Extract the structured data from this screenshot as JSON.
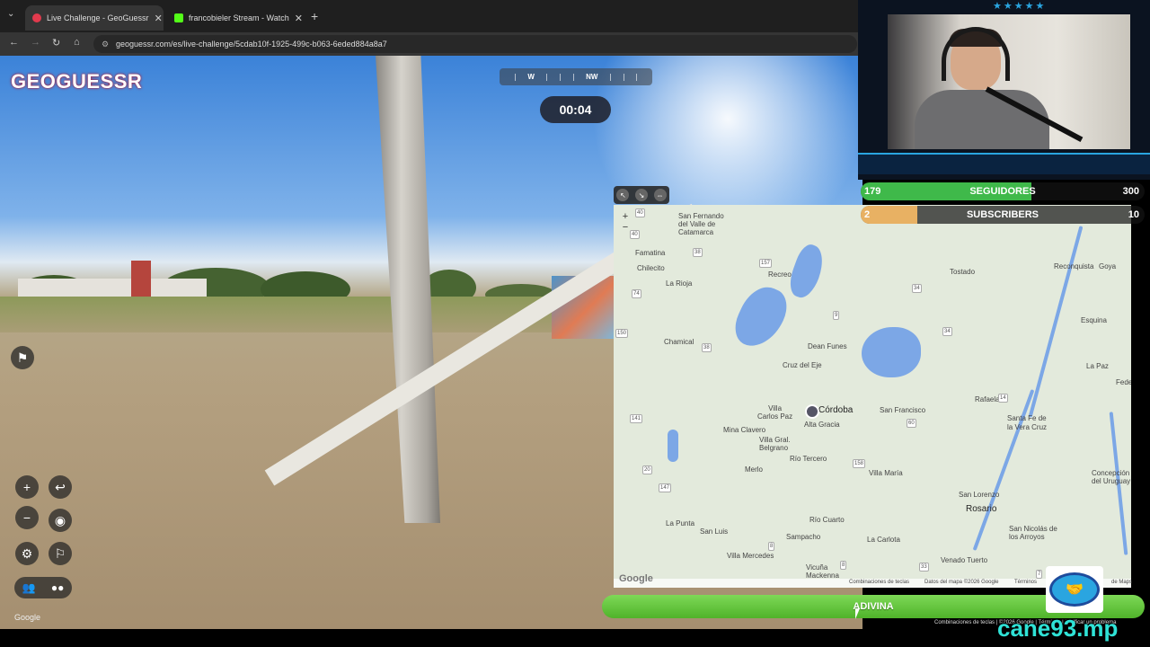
{
  "browser": {
    "tabs": [
      {
        "title": "Live Challenge - GeoGuessr",
        "active": true,
        "favicon_color": "#e23a4d"
      },
      {
        "title": "francobieler Stream - Watch",
        "active": false,
        "favicon_color": "#53fc18"
      }
    ],
    "url": "geoguessr.com/es/live-challenge/5cdab10f-1925-499c-b063-6eded884a8a7"
  },
  "game": {
    "logo": "GEOGUESSR",
    "compass": [
      "W",
      "NW"
    ],
    "timer": "00:04",
    "guess_button": "ADIVINA",
    "google_watermark": "Google"
  },
  "map": {
    "cities": [
      {
        "name": "San Fernando\ndel Valle de\nCatamarca",
        "key": "catamarca"
      },
      {
        "name": "Famatina",
        "key": "famatina"
      },
      {
        "name": "Chilecito",
        "key": "chilecito"
      },
      {
        "name": "La Rioja",
        "key": "larioja"
      },
      {
        "name": "Recreo",
        "key": "recreo"
      },
      {
        "name": "Tostado",
        "key": "tostado"
      },
      {
        "name": "Reconquista",
        "key": "reconquista"
      },
      {
        "name": "Goya",
        "key": "goya"
      },
      {
        "name": "Esquina",
        "key": "esquina"
      },
      {
        "name": "Chamical",
        "key": "chamical"
      },
      {
        "name": "Dean Funes",
        "key": "deanfunes"
      },
      {
        "name": "Cruz del Eje",
        "key": "cruzdeleje"
      },
      {
        "name": "La Paz",
        "key": "lapaz"
      },
      {
        "name": "Villa\nCarlos Paz",
        "key": "carlospaz"
      },
      {
        "name": "Córdoba",
        "key": "cordoba"
      },
      {
        "name": "Alta Gracia",
        "key": "altagracia"
      },
      {
        "name": "San Francisco",
        "key": "sanfrancisco"
      },
      {
        "name": "Rafaela",
        "key": "rafaela"
      },
      {
        "name": "Santa Fe de\nla Vera Cruz",
        "key": "santafe"
      },
      {
        "name": "Mina Clavero",
        "key": "minaclavero"
      },
      {
        "name": "Villa Gral.\nBelgrano",
        "key": "villagral"
      },
      {
        "name": "Merlo",
        "key": "merlo"
      },
      {
        "name": "Río Tercero",
        "key": "riotercero"
      },
      {
        "name": "Villa María",
        "key": "villamaria"
      },
      {
        "name": "Concepción\ndel Uruguay",
        "key": "concepcion"
      },
      {
        "name": "San Lorenzo",
        "key": "sanlorenzo"
      },
      {
        "name": "Rosario",
        "key": "rosario"
      },
      {
        "name": "La Punta",
        "key": "lapunta"
      },
      {
        "name": "Río Cuarto",
        "key": "riocuarto"
      },
      {
        "name": "San Luis",
        "key": "sanluis"
      },
      {
        "name": "Sampacho",
        "key": "sampacho"
      },
      {
        "name": "La Carlota",
        "key": "lacarlota"
      },
      {
        "name": "San Nicolás de\nlos Arroyos",
        "key": "sannicolas"
      },
      {
        "name": "Villa Mercedes",
        "key": "villamercedes"
      },
      {
        "name": "Venado Tuerto",
        "key": "venadotuerto"
      },
      {
        "name": "Vicuña\nMackenna",
        "key": "vicuna"
      },
      {
        "name": "Fede",
        "key": "fede"
      }
    ],
    "roads": [
      "40",
      "40",
      "38",
      "157",
      "157",
      "34",
      "12",
      "60",
      "74",
      "9",
      "34",
      "150",
      "38",
      "60",
      "19",
      "14",
      "141",
      "20",
      "34",
      "147",
      "148",
      "34",
      "8",
      "33",
      "158",
      "8",
      "7"
    ],
    "footer": {
      "shortcuts": "Combinaciones de teclas",
      "data": "Datos del mapa ©2026 Google",
      "terms": "Términos",
      "report": "de Maps"
    },
    "google_mark": "Google"
  },
  "stream": {
    "followers": {
      "current": "179",
      "label": "SEGUIDORES",
      "goal": "300",
      "fraction": 0.6,
      "color": "#3fb94a"
    },
    "subscribers": {
      "current": "2",
      "label": "SUBSCRIBERS",
      "goal": "10",
      "fraction": 0.2,
      "color": "#e8b163"
    },
    "handle": "cane93.mp",
    "tiny_footer": "Combinaciones de teclas | ©2026 Google | Términos | Notificar un problema"
  }
}
